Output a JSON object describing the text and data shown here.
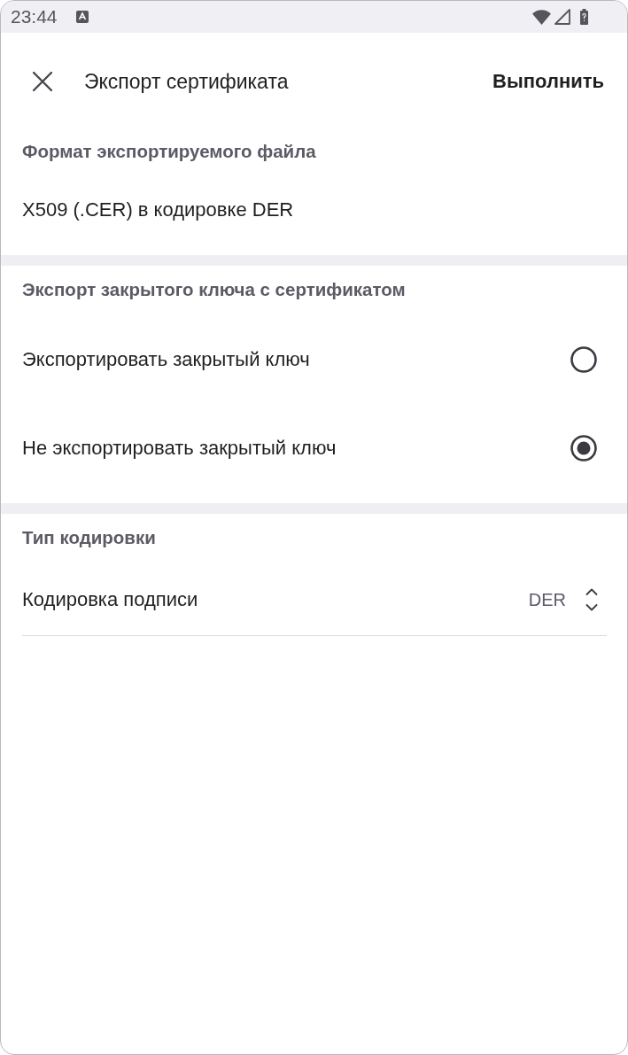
{
  "status_bar": {
    "time": "23:44"
  },
  "header": {
    "title": "Экспорт сертификата",
    "action": "Выполнить"
  },
  "sections": [
    {
      "title": "Формат экспортируемого файла",
      "items": [
        {
          "kind": "text",
          "label": "X509 (.CER) в кодировке DER"
        }
      ]
    },
    {
      "title": "Экспорт закрытого ключа с сертификатом",
      "items": [
        {
          "kind": "radio",
          "label": "Экспортировать закрытый ключ",
          "selected": false
        },
        {
          "kind": "radio",
          "label": "Не экспортировать закрытый ключ",
          "selected": true
        }
      ]
    },
    {
      "title": "Тип кодировки",
      "items": [
        {
          "kind": "select",
          "label": "Кодировка подписи",
          "value": "DER"
        }
      ]
    }
  ]
}
